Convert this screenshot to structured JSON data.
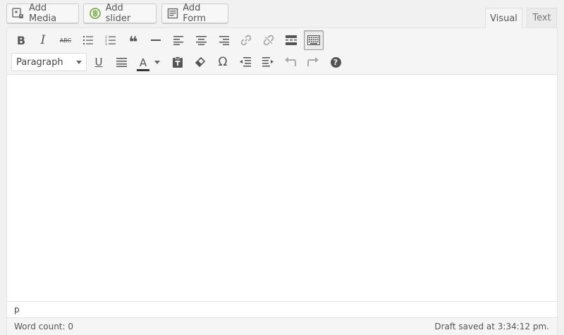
{
  "media_buttons": {
    "add_media": "Add Media",
    "add_slider": "Add slider",
    "add_form": "Add Form"
  },
  "tabs": {
    "visual": "Visual",
    "text": "Text",
    "active": "Visual"
  },
  "toolbar": {
    "row1_icons": [
      "bold-icon",
      "italic-icon",
      "strikethrough-icon",
      "bulleted-list-icon",
      "numbered-list-icon",
      "blockquote-icon",
      "horizontal-line-icon",
      "align-left-icon",
      "align-center-icon",
      "align-right-icon",
      "insert-link-icon",
      "remove-link-icon",
      "read-more-icon",
      "toolbar-toggle-icon"
    ],
    "row2_icons": [
      "underline-icon",
      "justify-icon",
      "text-color-icon",
      "paste-as-text-icon",
      "clear-formatting-icon",
      "special-character-icon",
      "decrease-indent-icon",
      "increase-indent-icon",
      "undo-icon",
      "redo-icon",
      "help-icon"
    ],
    "format_select": {
      "selected": "Paragraph"
    },
    "glyphs": {
      "bold": "B",
      "italic": "I",
      "strikethrough": "ABC",
      "blockquote": "❝",
      "underline": "U",
      "text_color": "A",
      "omega": "Ω",
      "help": "?"
    }
  },
  "editor": {
    "path": "p",
    "word_count": "Word count: 0",
    "draft_status": "Draft saved at 3:34:12 pm."
  },
  "colors": {
    "slider_icon": "#6aa33a",
    "toolbar_bg": "#f5f5f5",
    "border": "#e5e5e5"
  }
}
